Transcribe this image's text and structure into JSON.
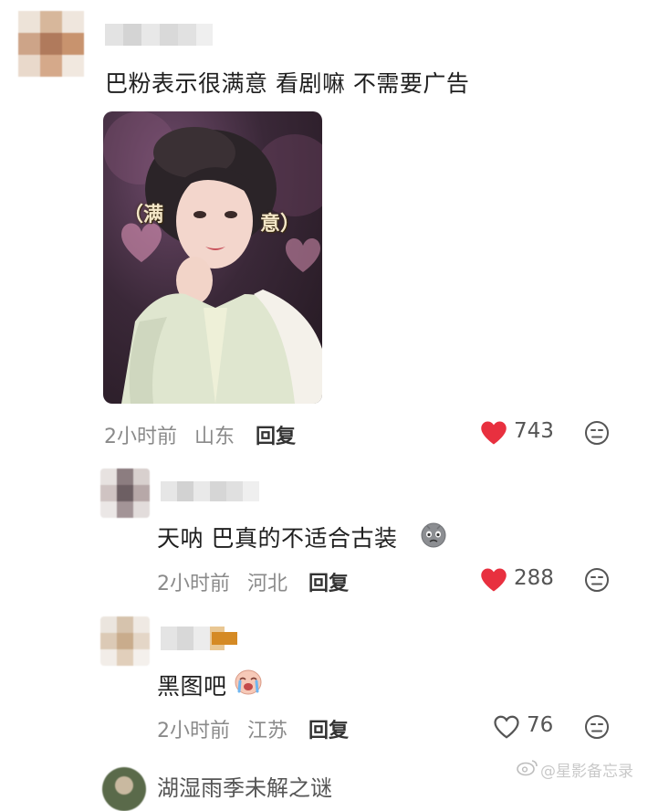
{
  "comments": [
    {
      "text": "巴粉表示很满意 看剧嘛 不需要广告",
      "time": "2小时前",
      "location": "山东",
      "reply_label": "回复",
      "likes": "743",
      "liked": true,
      "image": {
        "overlay_left": "（满",
        "overlay_right": "意）"
      }
    },
    {
      "text": "天呐 巴真的不适合古装",
      "emoji": "sad-face-emoji",
      "time": "2小时前",
      "location": "河北",
      "reply_label": "回复",
      "likes": "288",
      "liked": true
    },
    {
      "text": "黑图吧",
      "emoji": "crying-face-emoji",
      "time": "2小时前",
      "location": "江苏",
      "reply_label": "回复",
      "likes": "76",
      "liked": false
    }
  ],
  "next_comment": {
    "username": "湖湿雨季未解之谜"
  },
  "watermark": "@星影备忘录",
  "colors": {
    "like_red": "#e8303f",
    "meta_gray": "#8a8a8a"
  },
  "icons": [
    "heart-icon",
    "meh-face-icon",
    "weibo-logo-icon"
  ]
}
